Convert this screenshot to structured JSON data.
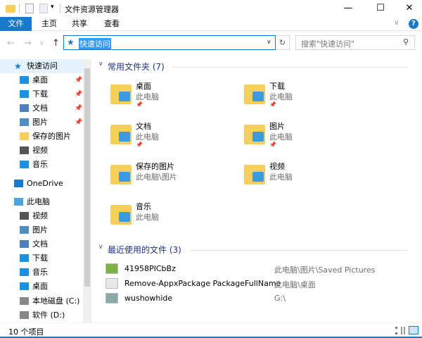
{
  "window": {
    "title": "文件资源管理器",
    "minimize": "—",
    "maximize": "☐",
    "close": "✕"
  },
  "ribbon": {
    "tabs": [
      "文件",
      "主页",
      "共享",
      "查看"
    ],
    "help": "?",
    "expand": "∨"
  },
  "nav": {
    "back": "←",
    "forward": "→",
    "recent": "∨",
    "up": "↑"
  },
  "address": {
    "value": "快速访问",
    "dropdown": "∨",
    "refresh": "↻"
  },
  "search": {
    "placeholder": "搜索\"快速访问\"",
    "icon": "search-icon"
  },
  "sidebar": {
    "items": [
      {
        "label": "快速访问",
        "icon": "star-icon",
        "color": "#1979ca"
      },
      {
        "label": "桌面",
        "icon": "desktop-icon",
        "pinned": true,
        "color": "#1e90e0"
      },
      {
        "label": "下载",
        "icon": "download-icon",
        "pinned": true,
        "color": "#1e90e0"
      },
      {
        "label": "文档",
        "icon": "document-icon",
        "pinned": true,
        "color": "#4f7fbf"
      },
      {
        "label": "图片",
        "icon": "pictures-icon",
        "pinned": true,
        "color": "#4f8fbf"
      },
      {
        "label": "保存的图片",
        "icon": "folder-icon",
        "color": "#f4cf5c"
      },
      {
        "label": "视频",
        "icon": "video-icon",
        "color": "#555"
      },
      {
        "label": "音乐",
        "icon": "music-icon",
        "color": "#1e90e0"
      },
      {
        "label": "OneDrive",
        "icon": "onedrive-icon",
        "color": "#1979ca"
      },
      {
        "label": "此电脑",
        "icon": "computer-icon",
        "color": "#4aa3df"
      },
      {
        "label": "视频",
        "icon": "video-icon",
        "color": "#555"
      },
      {
        "label": "图片",
        "icon": "pictures-icon",
        "color": "#4f8fbf"
      },
      {
        "label": "文档",
        "icon": "document-icon",
        "color": "#4f7fbf"
      },
      {
        "label": "下载",
        "icon": "download-icon",
        "color": "#1e90e0"
      },
      {
        "label": "音乐",
        "icon": "music-icon",
        "color": "#1e90e0"
      },
      {
        "label": "桌面",
        "icon": "desktop-icon",
        "color": "#1e90e0"
      },
      {
        "label": "本地磁盘 (C:)",
        "icon": "drive-icon",
        "color": "#888"
      },
      {
        "label": "软件 (D:)",
        "icon": "drive-icon",
        "color": "#888"
      }
    ],
    "pin": "📌"
  },
  "frequent": {
    "title": "常用文件夹 (7)",
    "folders": [
      {
        "name": "桌面",
        "location": "此电脑",
        "pinned": true,
        "icon": "desktop-folder-icon"
      },
      {
        "name": "下载",
        "location": "此电脑",
        "pinned": true,
        "icon": "download-folder-icon"
      },
      {
        "name": "文档",
        "location": "此电脑",
        "pinned": true,
        "icon": "documents-folder-icon"
      },
      {
        "name": "图片",
        "location": "此电脑",
        "pinned": true,
        "icon": "pictures-folder-icon"
      },
      {
        "name": "保存的图片",
        "location": "此电脑\\图片",
        "icon": "saved-pictures-folder-icon"
      },
      {
        "name": "视频",
        "location": "此电脑",
        "icon": "videos-folder-icon"
      },
      {
        "name": "音乐",
        "location": "此电脑",
        "icon": "music-folder-icon"
      }
    ]
  },
  "recent": {
    "title": "最近使用的文件 (3)",
    "files": [
      {
        "name": "41958PICbBz",
        "location": "此电脑\\图片\\Saved Pictures",
        "icon": "image-file-icon"
      },
      {
        "name": "Remove-AppxPackage PackageFullName",
        "location": "此电脑\\桌面",
        "icon": "text-file-icon"
      },
      {
        "name": "wushowhide",
        "location": "G:\\",
        "icon": "program-file-icon"
      }
    ]
  },
  "status": {
    "count": "10 个项目"
  },
  "colors": {
    "accent": "#1979ca",
    "group_header": "#1e3287"
  }
}
